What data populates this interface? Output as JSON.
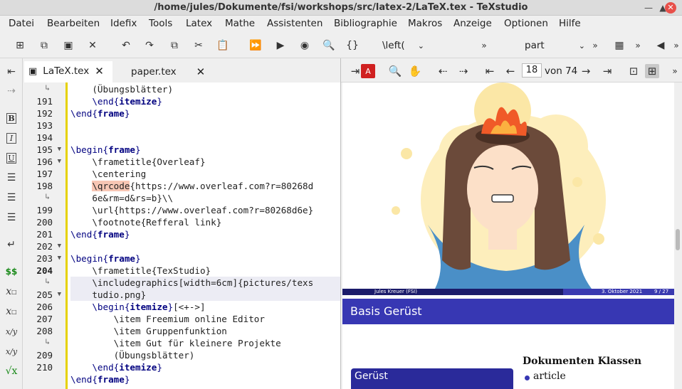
{
  "window": {
    "title": "/home/jules/Dokumente/fsi/workshops/src/latex-2/LaTeX.tex - TeXstudio"
  },
  "menu": [
    "Datei",
    "Bearbeiten",
    "Idefix",
    "Tools",
    "Latex",
    "Mathe",
    "Assistenten",
    "Bibliographie",
    "Makros",
    "Anzeige",
    "Optionen",
    "Hilfe"
  ],
  "toolbar": {
    "left_combo": "\\left(",
    "structure_combo": "part"
  },
  "tabs": [
    {
      "label": "LaTeX.tex"
    },
    {
      "label": "paper.tex"
    }
  ],
  "editor": {
    "gutter": [
      {
        "n": "",
        "wrap": true
      },
      {
        "n": "191"
      },
      {
        "n": "192"
      },
      {
        "n": "193"
      },
      {
        "n": "194"
      },
      {
        "n": "195",
        "fold": true
      },
      {
        "n": "196",
        "fold": true
      },
      {
        "n": "197"
      },
      {
        "n": "198"
      },
      {
        "n": "",
        "wrap": true
      },
      {
        "n": "199"
      },
      {
        "n": "200"
      },
      {
        "n": "201"
      },
      {
        "n": "202",
        "fold": true
      },
      {
        "n": "203",
        "fold": true
      },
      {
        "n": "204",
        "bold": true
      },
      {
        "n": "",
        "wrap": true
      },
      {
        "n": "205",
        "fold": true
      },
      {
        "n": "206"
      },
      {
        "n": "207"
      },
      {
        "n": "208"
      },
      {
        "n": "",
        "wrap": true
      },
      {
        "n": "209"
      },
      {
        "n": "210"
      }
    ],
    "lines": [
      "    (Übungsblätter)",
      "    \\end{itemize}",
      "\\end{frame}",
      "",
      "",
      "\\begin{frame}",
      "    \\frametitle{Overleaf}",
      "    \\centering",
      "    \\qrcode{https://www.overleaf.com?r=80268d",
      "    6e&rm=d&rs=b}\\\\",
      "    \\url{https://www.overleaf.com?r=80268d6e}",
      "    \\footnote{Refferal link}",
      "\\end{frame}",
      "",
      "\\begin{frame}",
      "    \\frametitle{TexStudio}",
      "    \\includegraphics[width=6cm]{pictures/texs",
      "    tudio.png}",
      "    \\begin{itemize}[<+->]",
      "        \\item Freemium online Editor",
      "        \\item Gruppenfunktion",
      "        \\item Gut für kleinere Projekte",
      "        (Übungsblätter)",
      "    \\end{itemize}",
      "\\end{frame}"
    ]
  },
  "pdf": {
    "page": "18",
    "of_pages": "von 74",
    "footer_author": "Jules Kreuer  (FSI)",
    "footer_date": "3. Oktober 2021",
    "footer_pages": "9 / 27",
    "slide_title": "Basis Gerüst",
    "block_title": "Gerüst",
    "section_title": "Dokumenten Klassen",
    "bullet_1": "article"
  },
  "colors": {
    "accent": "#3737b3",
    "change_marker": "#e6d200",
    "command_highlight": "#f7c6b4"
  }
}
